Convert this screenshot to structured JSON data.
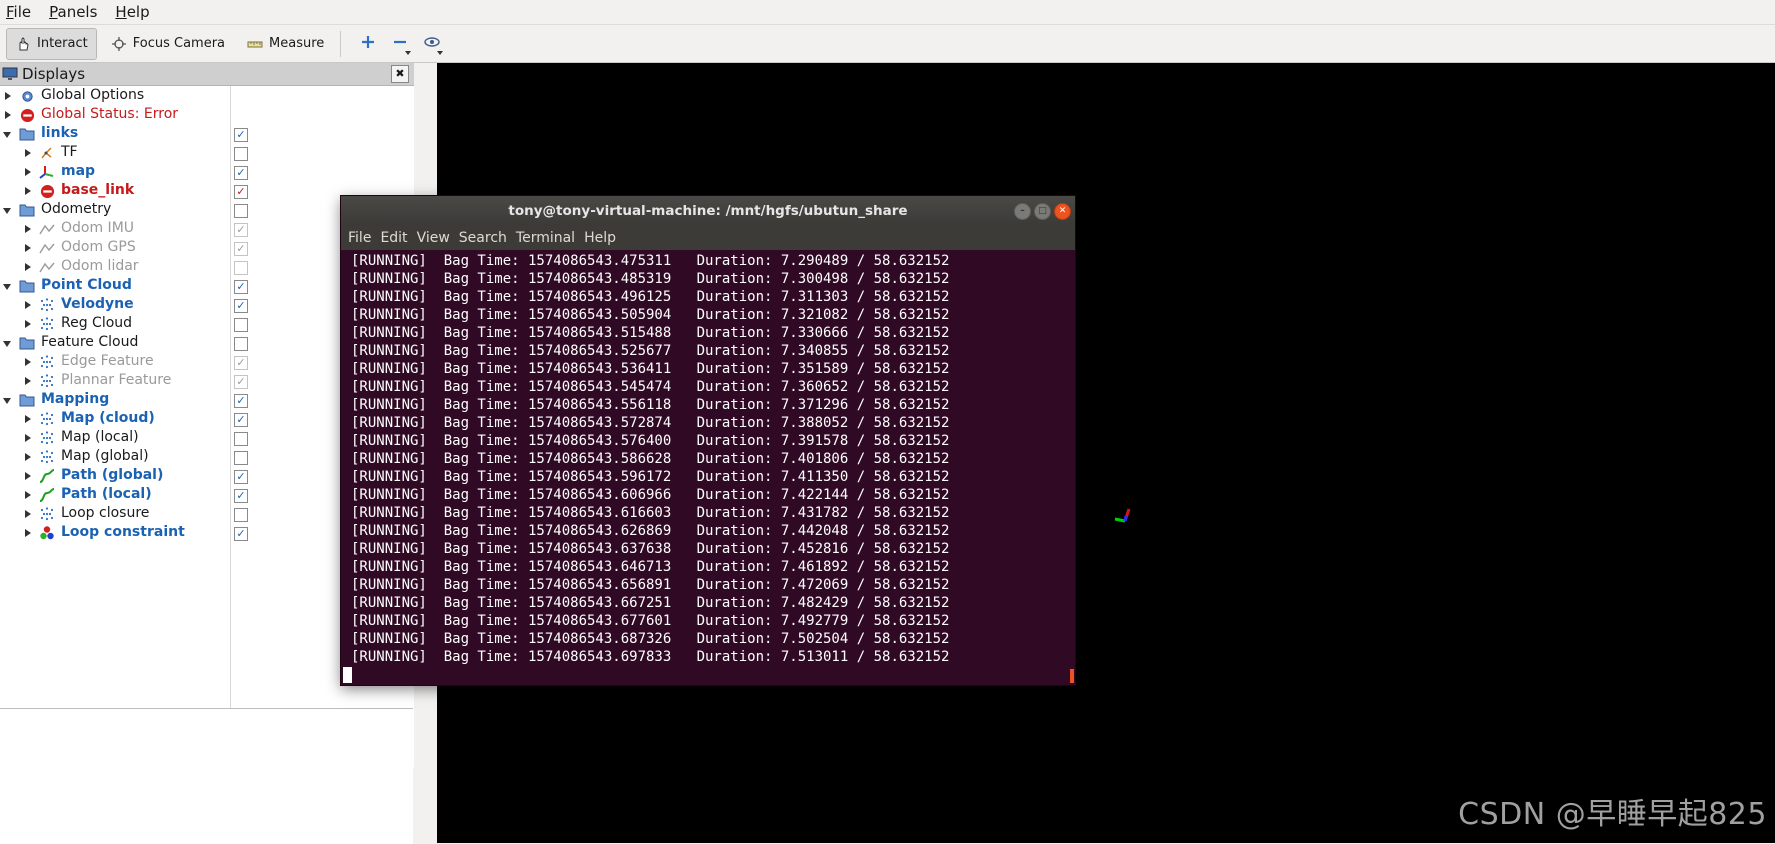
{
  "menubar": {
    "items": [
      "File",
      "Panels",
      "Help"
    ]
  },
  "toolbar": {
    "interact": "Interact",
    "focus_camera": "Focus Camera",
    "measure": "Measure"
  },
  "displays": {
    "title": "Displays",
    "tree": [
      {
        "label": "Global Options",
        "icon": "gear-icon",
        "style": "normal",
        "check": null
      },
      {
        "label": "Global Status: Error",
        "icon": "error-icon",
        "style": "red",
        "check": null
      },
      {
        "label": "links",
        "icon": "folder-icon",
        "style": "blue",
        "check": "on"
      },
      {
        "label": "TF",
        "icon": "tf-icon",
        "style": "normal",
        "check": "off"
      },
      {
        "label": "map",
        "icon": "axes-icon",
        "style": "blue",
        "check": "on"
      },
      {
        "label": "base_link",
        "icon": "error-icon",
        "style": "redbold",
        "check": "on"
      },
      {
        "label": "Odometry",
        "icon": "folder-icon",
        "style": "normal",
        "check": "off"
      },
      {
        "label": "Odom IMU",
        "icon": "odometry-icon",
        "style": "gray",
        "check": "on"
      },
      {
        "label": "Odom GPS",
        "icon": "odometry-icon",
        "style": "gray",
        "check": "on"
      },
      {
        "label": "Odom lidar",
        "icon": "odometry-icon",
        "style": "gray",
        "check": "off"
      },
      {
        "label": "Point Cloud",
        "icon": "folder-icon",
        "style": "blue",
        "check": "on"
      },
      {
        "label": "Velodyne",
        "icon": "pointcloud-icon",
        "style": "blue",
        "check": "on"
      },
      {
        "label": "Reg Cloud",
        "icon": "pointcloud-icon",
        "style": "normal",
        "check": "off"
      },
      {
        "label": "Feature Cloud",
        "icon": "folder-icon",
        "style": "normal",
        "check": "off"
      },
      {
        "label": "Edge Feature",
        "icon": "pointcloud-icon",
        "style": "gray",
        "check": "on"
      },
      {
        "label": "Plannar Feature",
        "icon": "pointcloud-icon",
        "style": "gray",
        "check": "on"
      },
      {
        "label": "Mapping",
        "icon": "folder-icon",
        "style": "blue",
        "check": "on"
      },
      {
        "label": "Map (cloud)",
        "icon": "pointcloud-icon",
        "style": "blue",
        "check": "on"
      },
      {
        "label": "Map (local)",
        "icon": "pointcloud-icon",
        "style": "normal",
        "check": "off"
      },
      {
        "label": "Map (global)",
        "icon": "pointcloud-icon",
        "style": "normal",
        "check": "off"
      },
      {
        "label": "Path (global)",
        "icon": "path-icon",
        "style": "blue",
        "check": "on"
      },
      {
        "label": "Path (local)",
        "icon": "path-icon",
        "style": "blue",
        "check": "on"
      },
      {
        "label": "Loop closure",
        "icon": "pointcloud-icon",
        "style": "normal",
        "check": "off"
      },
      {
        "label": "Loop constraint",
        "icon": "marker-icon",
        "style": "blue",
        "check": "on"
      }
    ]
  },
  "terminal": {
    "title": "tony@tony-virtual-machine: /mnt/hgfs/ubutun_share",
    "menu": [
      "File",
      "Edit",
      "View",
      "Search",
      "Terminal",
      "Help"
    ],
    "lines": [
      "[RUNNING]  Bag Time: 1574086543.475311   Duration: 7.290489 / 58.632152",
      "[RUNNING]  Bag Time: 1574086543.485319   Duration: 7.300498 / 58.632152",
      "[RUNNING]  Bag Time: 1574086543.496125   Duration: 7.311303 / 58.632152",
      "[RUNNING]  Bag Time: 1574086543.505904   Duration: 7.321082 / 58.632152",
      "[RUNNING]  Bag Time: 1574086543.515488   Duration: 7.330666 / 58.632152",
      "[RUNNING]  Bag Time: 1574086543.525677   Duration: 7.340855 / 58.632152",
      "[RUNNING]  Bag Time: 1574086543.536411   Duration: 7.351589 / 58.632152",
      "[RUNNING]  Bag Time: 1574086543.545474   Duration: 7.360652 / 58.632152",
      "[RUNNING]  Bag Time: 1574086543.556118   Duration: 7.371296 / 58.632152",
      "[RUNNING]  Bag Time: 1574086543.572874   Duration: 7.388052 / 58.632152",
      "[RUNNING]  Bag Time: 1574086543.576400   Duration: 7.391578 / 58.632152",
      "[RUNNING]  Bag Time: 1574086543.586628   Duration: 7.401806 / 58.632152",
      "[RUNNING]  Bag Time: 1574086543.596172   Duration: 7.411350 / 58.632152",
      "[RUNNING]  Bag Time: 1574086543.606966   Duration: 7.422144 / 58.632152",
      "[RUNNING]  Bag Time: 1574086543.616603   Duration: 7.431782 / 58.632152",
      "[RUNNING]  Bag Time: 1574086543.626869   Duration: 7.442048 / 58.632152",
      "[RUNNING]  Bag Time: 1574086543.637638   Duration: 7.452816 / 58.632152",
      "[RUNNING]  Bag Time: 1574086543.646713   Duration: 7.461892 / 58.632152",
      "[RUNNING]  Bag Time: 1574086543.656891   Duration: 7.472069 / 58.632152",
      "[RUNNING]  Bag Time: 1574086543.667251   Duration: 7.482429 / 58.632152",
      "[RUNNING]  Bag Time: 1574086543.677601   Duration: 7.492779 / 58.632152",
      "[RUNNING]  Bag Time: 1574086543.687326   Duration: 7.502504 / 58.632152",
      "[RUNNING]  Bag Time: 1574086543.697833   Duration: 7.513011 / 58.632152"
    ]
  },
  "watermark": "CSDN @早睡早起825",
  "colors": {
    "blue_label": "#1b62b3",
    "red_label": "#c61a1a",
    "terminal_bg": "#300a24",
    "view_bg": "#000000"
  }
}
